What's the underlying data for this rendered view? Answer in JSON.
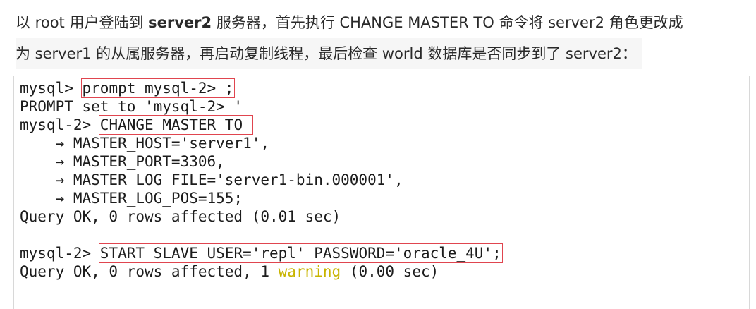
{
  "intro": {
    "line1_a": "以 root 用户登陆到 ",
    "line1_bold": "server2",
    "line1_b": " 服务器，首先执行 CHANGE MASTER TO 命令将 server2 角色更改成",
    "line2": "为 server1 的从属服务器，再启动复制线程，最后检查 world 数据库是否同步到了 server2："
  },
  "terminal": {
    "l1_prompt": "mysql> ",
    "l1_cmd": "prompt mysql-2> ;",
    "l2": "PROMPT set to 'mysql-2> '",
    "l3_prompt": "mysql-2> ",
    "l3_cmd": "CHANGE MASTER TO ",
    "l4": "    → MASTER_HOST='server1',",
    "l5": "    → MASTER_PORT=3306,",
    "l6": "    → MASTER_LOG_FILE='server1-bin.000001',",
    "l7": "    → MASTER_LOG_POS=155;",
    "l8": "Query OK, 0 rows affected (0.01 sec)",
    "l10_prompt": "mysql-2> ",
    "l10_cmd": "START SLAVE USER='repl' PASSWORD='oracle_4U';",
    "l11_a": "Query OK, 0 rows affected, 1 ",
    "l11_warn": "warning",
    "l11_b": " (0.00 sec)"
  },
  "colors": {
    "highlight_box": "#e0454f",
    "warning_text": "#c8b400"
  }
}
